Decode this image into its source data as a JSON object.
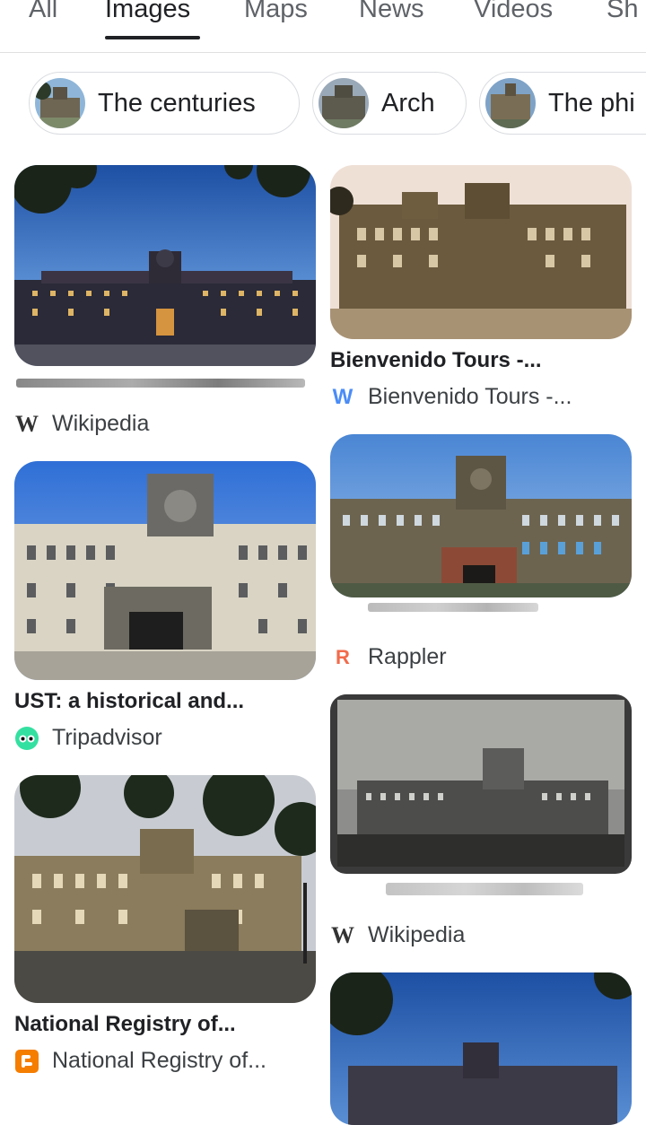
{
  "tabs": {
    "all": "All",
    "images": "Images",
    "maps": "Maps",
    "news": "News",
    "videos": "Videos",
    "shopping": "Sh"
  },
  "chips": [
    {
      "label": "The centuries"
    },
    {
      "label": "Arch"
    },
    {
      "label": "The phi"
    }
  ],
  "results": {
    "r1": {
      "source": "Wikipedia",
      "icon": "wikipedia-icon"
    },
    "r2": {
      "title": "Bienvenido Tours -...",
      "source": "Bienvenido Tours -...",
      "icon": "bienvenido-w-icon",
      "icon_color": "#4a8cf7"
    },
    "r3": {
      "title": "UST: a historical and...",
      "source": "Tripadvisor",
      "icon": "tripadvisor-icon",
      "icon_color": "#34e0a1"
    },
    "r4": {
      "source": "Rappler",
      "icon": "rappler-icon",
      "icon_color": "#f26b4b"
    },
    "r5": {
      "title": "National Registry of...",
      "source": "National Registry of...",
      "icon": "blogger-icon",
      "icon_color": "#f57d00"
    },
    "r6": {
      "source": "Wikipedia",
      "icon": "wikipedia-icon"
    }
  }
}
